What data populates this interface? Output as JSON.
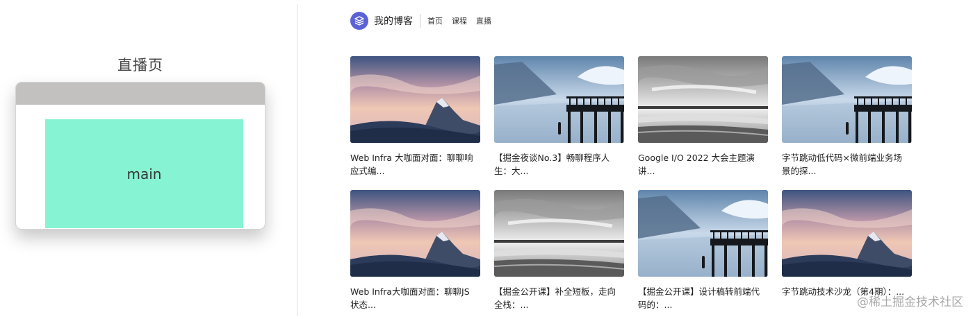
{
  "diagram": {
    "title": "直播页",
    "main_label": "main"
  },
  "header": {
    "blog_name": "我的博客",
    "nav": [
      "首页",
      "课程",
      "直播"
    ],
    "logo_icon": "layers-icon",
    "brand_color": "#5b62d6"
  },
  "cards": [
    {
      "title": "Web Infra 大咖面对面：聊聊响应式编...",
      "image": "mountain-sunset"
    },
    {
      "title": "【掘金夜谈No.3】畅聊程序人生：大...",
      "image": "lake-pier"
    },
    {
      "title": "Google I/O 2022 大会主题演讲...",
      "image": "gray-seascape"
    },
    {
      "title": "字节跳动低代码×微前端业务场景的探...",
      "image": "lake-pier"
    },
    {
      "title": "Web Infra大咖面对面：聊聊JS状态...",
      "image": "mountain-sunset"
    },
    {
      "title": "【掘金公开课】补全短板，走向全栈：...",
      "image": "gray-seascape"
    },
    {
      "title": "【掘金公开课】设计稿转前端代码的：...",
      "image": "lake-pier"
    },
    {
      "title": "字节跳动技术沙龙（第4期）：...",
      "image": "mountain-sunset"
    }
  ],
  "watermark": "@稀土掘金技术社区",
  "colors": {
    "main_area": "#86f4d3",
    "mock_header": "#c2c1bf"
  }
}
